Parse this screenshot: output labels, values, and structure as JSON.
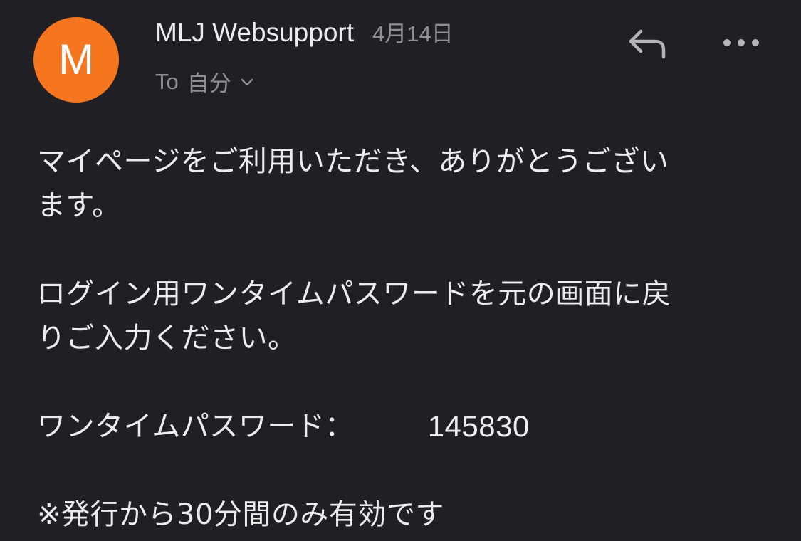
{
  "email": {
    "sender": {
      "initial": "M",
      "name": "MLJ Websupport",
      "date": "4月14日",
      "avatar_color": "#f5761e"
    },
    "recipient": {
      "to_label": "To",
      "value": "自分"
    },
    "actions": {
      "reply_icon": "reply-icon",
      "more_icon": "more-icon"
    },
    "body": {
      "line1": "マイページをご利用いただき、ありがとうござい",
      "line2": "ます。",
      "line3": "ログイン用ワンタイムパスワードを元の画面に戻",
      "line4": "りご入力ください。",
      "otp_label": "ワンタイムパスワード：",
      "otp_value": "145830",
      "note": "※発行から30分間のみ有効です"
    }
  }
}
